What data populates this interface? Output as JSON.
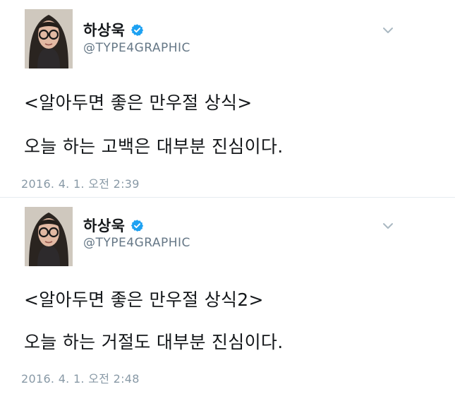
{
  "tweets": [
    {
      "display_name": "하상욱",
      "handle": "@TYPE4GRAPHIC",
      "lines": [
        "<알아두면 좋은 만우절 상식>",
        "오늘 하는 고백은 대부분 진심이다."
      ],
      "timestamp": "2016. 4. 1. 오전 2:39"
    },
    {
      "display_name": "하상욱",
      "handle": "@TYPE4GRAPHIC",
      "lines": [
        "<알아두면 좋은 만우절 상식2>",
        "오늘 하는 거절도 대부분 진심이다."
      ],
      "timestamp": "2016. 4. 1. 오전 2:48"
    }
  ],
  "icons": {
    "verified": "verified-badge-icon",
    "menu": "chevron-down-icon"
  },
  "colors": {
    "verified_blue": "#1da1f2",
    "secondary_text": "#657786",
    "timestamp_text": "#8899a6"
  }
}
